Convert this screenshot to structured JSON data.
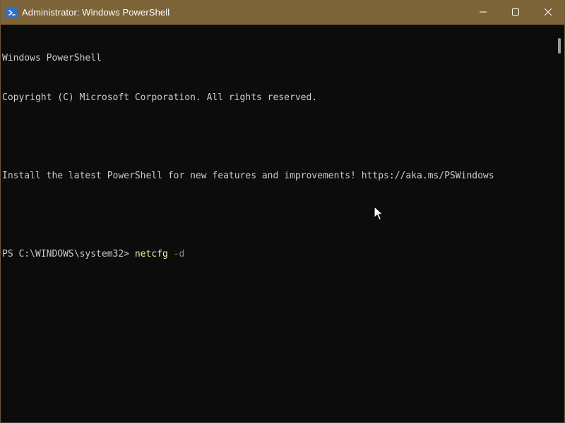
{
  "window": {
    "title": "Administrator: Windows PowerShell",
    "titlebar_color": "#7c6338",
    "background_color": "#0c0c0c"
  },
  "controls": {
    "minimize_icon": "minimize-icon",
    "maximize_icon": "maximize-icon",
    "close_icon": "close-icon"
  },
  "console": {
    "banner": "Windows PowerShell",
    "copyright": "Copyright (C) Microsoft Corporation. All rights reserved.",
    "install_message": "Install the latest PowerShell for new features and improvements! https://aka.ms/PSWindows",
    "prompt": "PS C:\\WINDOWS\\system32> ",
    "command": "netcfg",
    "parameter": "-d",
    "text_color": "#cccccc",
    "command_color": "#f9f1a5",
    "parameter_color": "#8a8a8a"
  }
}
